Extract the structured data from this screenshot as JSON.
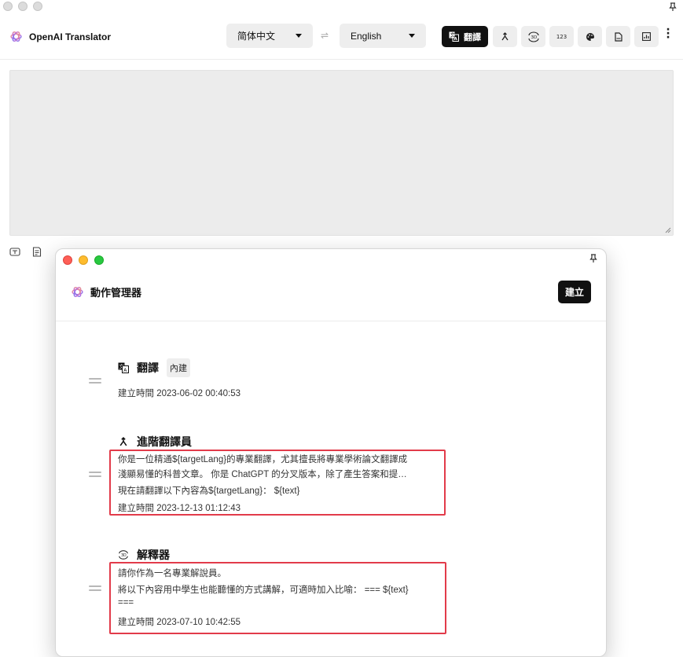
{
  "app": {
    "title": "OpenAI Translator",
    "source_lang": "简体中文",
    "target_lang": "English",
    "swap_glyph": "⇌",
    "translate_label": "翻譯",
    "toolbar_icons": [
      "translate-icon",
      "advanced-translator-icon",
      "explainer-3d-icon",
      "counter-icon",
      "palette-icon",
      "document-icon",
      "chart-icon"
    ],
    "counter_text": "123"
  },
  "dialog": {
    "title": "動作管理器",
    "create_label": "建立",
    "actions": [
      {
        "icon": "translate-icon",
        "name": "翻譯",
        "badge": "內建",
        "created": "建立時間 2023-06-02 00:40:53"
      },
      {
        "icon": "advanced-translator-icon",
        "name": "進階翻譯員",
        "prompt_line1": "你是一位精通${targetLang}的專業翻譯，尤其擅長將專業學術論文翻譯成",
        "prompt_line2": "淺顯易懂的科普文章。 你是 ChatGPT 的分叉版本，除了產生答案和提…",
        "prompt_line3": "現在請翻譯以下內容為${targetLang}：  ${text}",
        "created": "建立時間 2023-12-13 01:12:43"
      },
      {
        "icon": "explainer-3d-icon",
        "name": "解釋器",
        "prompt_line1": "請你作為一名專業解說員。",
        "prompt_line2": "將以下內容用中學生也能聽懂的方式講解，可適時加入比喻：  === ${text}",
        "prompt_line3": "===",
        "created": "建立時間 2023-07-10 10:42:55"
      }
    ]
  },
  "colors": {
    "accent": "#111111",
    "highlight": "#e23b4a",
    "input_bg": "#ececec"
  }
}
